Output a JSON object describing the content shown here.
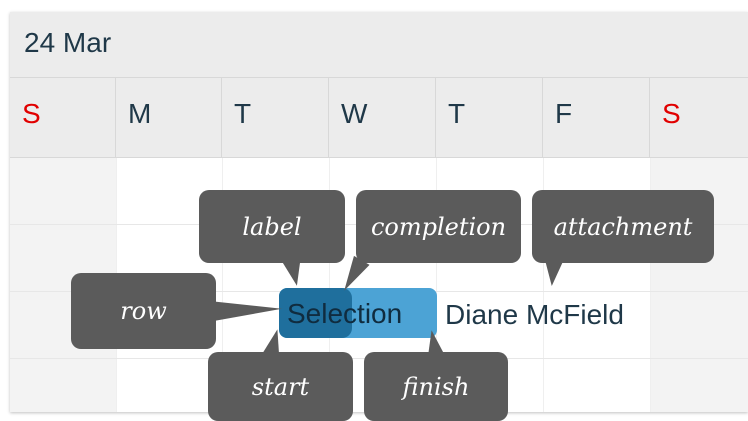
{
  "timeline": {
    "month_label": "24 Mar",
    "days": [
      "S",
      "M",
      "T",
      "W",
      "T",
      "F",
      "S"
    ]
  },
  "task": {
    "name": "Selection",
    "assignee": "Diane McField",
    "progress": 0.46
  },
  "annotations": {
    "label": "label",
    "completion": "completion",
    "attachment": "attachment",
    "row": "row",
    "start": "start",
    "finish": "finish"
  },
  "colors": {
    "weekend_text": "#e10000",
    "task_bar": "#4ca3d5",
    "task_progress": "#1f6f9d",
    "callout": "#5b5b5b"
  }
}
